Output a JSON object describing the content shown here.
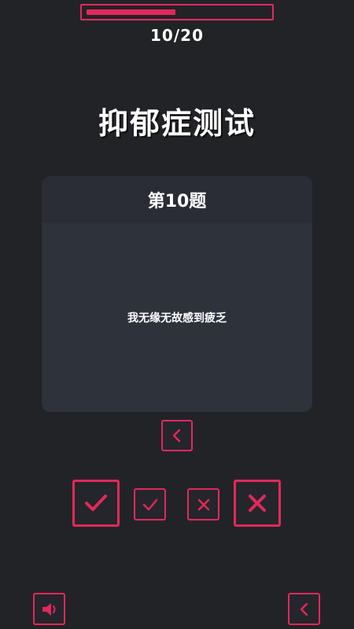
{
  "progress": {
    "text": "10/20",
    "current": 10,
    "total": 20,
    "bar_fill_fraction": 0.49,
    "color": "#e3285b"
  },
  "title": "抑郁症测试",
  "question": {
    "header": "第10题",
    "text": "我无缘无故感到疲乏"
  },
  "buttons": {
    "prev_question": "chevron-left-icon",
    "strong_yes": "check-icon",
    "yes": "check-icon",
    "no": "x-icon",
    "strong_no": "x-icon",
    "sound": "speaker-icon",
    "back": "chevron-left-icon"
  },
  "colors": {
    "background": "#222327",
    "accent": "#e3285b",
    "card": "#2e323b",
    "card_header": "#2a2d35"
  }
}
